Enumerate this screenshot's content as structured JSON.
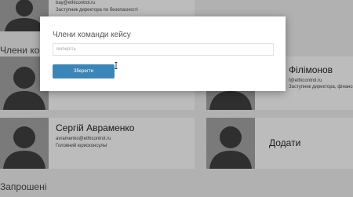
{
  "background": {
    "top_card": {
      "email": "bay@ethicontrol.ru",
      "position": "Заступник директора по безопасності"
    },
    "team_section_label": "Члени коман",
    "right_card_top": {
      "name": "Філімонов",
      "email": "f@ethicontrol.ru",
      "position": "Заступник директора, фінансов"
    },
    "card_avramenko": {
      "name": "Сергій Авраменко",
      "email": "avramenko@ethicontrol.ru",
      "position": "Головний юрисконсульт"
    },
    "add_card": {
      "label": "Додати"
    },
    "invited_section_label": "Запрошені"
  },
  "modal": {
    "title": "Члени команди кейсу",
    "input_placeholder": "Виберіть",
    "save_label": "Зберегти"
  },
  "colors": {
    "accent": "#3b86b8",
    "avatar": "#9a9a9a"
  }
}
